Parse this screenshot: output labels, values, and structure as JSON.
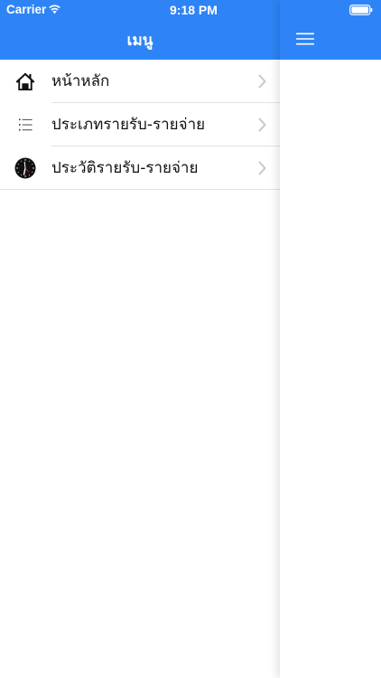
{
  "status_bar": {
    "carrier": "Carrier",
    "time": "9:18 PM"
  },
  "menu": {
    "title": "เมนู",
    "items": [
      {
        "label": "หน้าหลัก",
        "icon": "home-icon"
      },
      {
        "label": "ประเภทรายรับ-รายจ่าย",
        "icon": "list-icon"
      },
      {
        "label": "ประวัติรายรับ-รายจ่าย",
        "icon": "clock-icon"
      }
    ]
  },
  "main": {
    "menu_button_icon": "hamburger-icon"
  },
  "colors": {
    "header_background": "#2e84f6",
    "header_text": "#ffffff",
    "separator": "#e2e2e2",
    "chevron": "#c7c7cc"
  }
}
